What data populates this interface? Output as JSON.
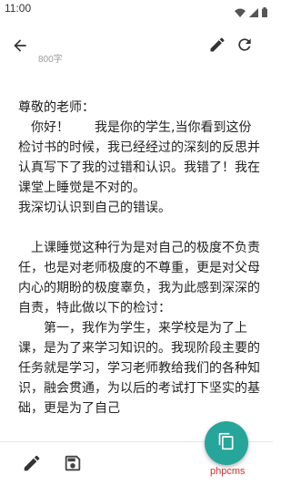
{
  "status": {
    "time": "11:00",
    "icons": [
      "wifi-icon",
      "signal-icon",
      "battery-icon"
    ]
  },
  "toolbar": {
    "back_icon": "arrow-left-icon",
    "word_count": "800字",
    "edit_icon": "pencil-icon",
    "refresh_icon": "refresh-icon"
  },
  "document": {
    "salutation": "尊敬的老师：",
    "paragraphs": [
      "　你好！　　我是你的学生,当你看到这份检讨书的时候，我已经经过的深刻的反思并认真写下了我的过错和认识。我错了！我在课堂上睡觉是不对的。",
      "我深切认识到自己的错误。",
      "　上课睡觉这种行为是对自己的极度不负责任，也是对老师极度的不尊重，更是对父母内心的期盼的极度辜负，我为此感到深深的自责，特此做以下的检讨：",
      "　　第一，我作为学生，来学校是为了上课，是为了来学习知识的。我现阶段主要的任务就是学习，学习老师教给我们的各种知识，融会贯通，为以后的考试打下坚实的基础，更是为了自己"
    ]
  },
  "bottom_bar": {
    "pencil_icon": "pencil-icon",
    "save_icon": "save-icon"
  },
  "fab": {
    "icon": "copy-icon"
  },
  "watermark": "phpcms",
  "colors": {
    "accent": "#26a69a",
    "watermark": "#d32f2f"
  }
}
